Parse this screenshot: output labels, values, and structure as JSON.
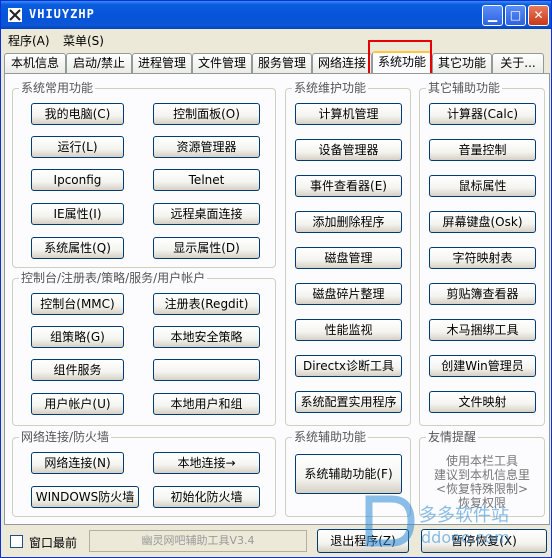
{
  "window": {
    "title": "VHIUYZHP"
  },
  "menu": [
    "程序(A)",
    "菜单(S)"
  ],
  "tabs": [
    {
      "label": "本机信息",
      "active": false
    },
    {
      "label": "启动/禁止",
      "active": false
    },
    {
      "label": "进程管理",
      "active": false
    },
    {
      "label": "文件管理",
      "active": false
    },
    {
      "label": "服务管理",
      "active": false
    },
    {
      "label": "网络连接",
      "active": false
    },
    {
      "label": "系统功能",
      "active": true
    },
    {
      "label": "其它功能",
      "active": false
    },
    {
      "label": "关于...",
      "active": false
    }
  ],
  "groups": {
    "common": {
      "title": "系统常用功能",
      "buttons": [
        "我的电脑(C)",
        "控制面板(O)",
        "运行(L)",
        "资源管理器",
        "Ipconfig",
        "Telnet",
        "IE属性(I)",
        "远程桌面连接",
        "系统属性(Q)",
        "显示属性(D)"
      ]
    },
    "console": {
      "title": "控制台/注册表/策略/服务/用户帐户",
      "buttons": [
        "控制台(MMC)",
        "注册表(Regdit)",
        "组策略(G)",
        "本地安全策略",
        "组件服务",
        "",
        "用户帐户(U)",
        "本地用户和组"
      ]
    },
    "network": {
      "title": "网络连接/防火墙",
      "buttons": [
        "网络连接(N)",
        "本地连接→",
        "WINDOWS防火墙",
        "初始化防火墙"
      ]
    },
    "maintenance": {
      "title": "系统维护功能",
      "buttons": [
        "计算机管理",
        "设备管理器",
        "事件查看器(E)",
        "添加删除程序",
        "磁盘管理",
        "磁盘碎片整理",
        "性能监视",
        "Directx诊断工具",
        "系统配置实用程序"
      ]
    },
    "assist": {
      "title": "系统辅助功能",
      "buttons": [
        "系统辅助功能(F)"
      ]
    },
    "other": {
      "title": "其它辅助功能",
      "buttons": [
        "计算器(Calc)",
        "音量控制",
        "鼠标属性",
        "屏幕键盘(Osk)",
        "字符映射表",
        "剪贴簿查看器",
        "木马捆绑工具",
        "创建Win管理员",
        "文件映射"
      ]
    },
    "friendly": {
      "title": "友情提醒",
      "lines": [
        "使用本栏工具",
        "建议到本机信息里",
        "<恢复特殊限制>",
        "恢复权限"
      ]
    }
  },
  "bottom": {
    "checkbox_label": "窗口最前",
    "status": "幽灵网吧辅助工具V3.4",
    "exit_button": "退出程序(Z)",
    "restore_button": "暂停恢复(X)"
  },
  "watermark": {
    "brand": "多多软件站",
    "url": "ddooo.com"
  }
}
